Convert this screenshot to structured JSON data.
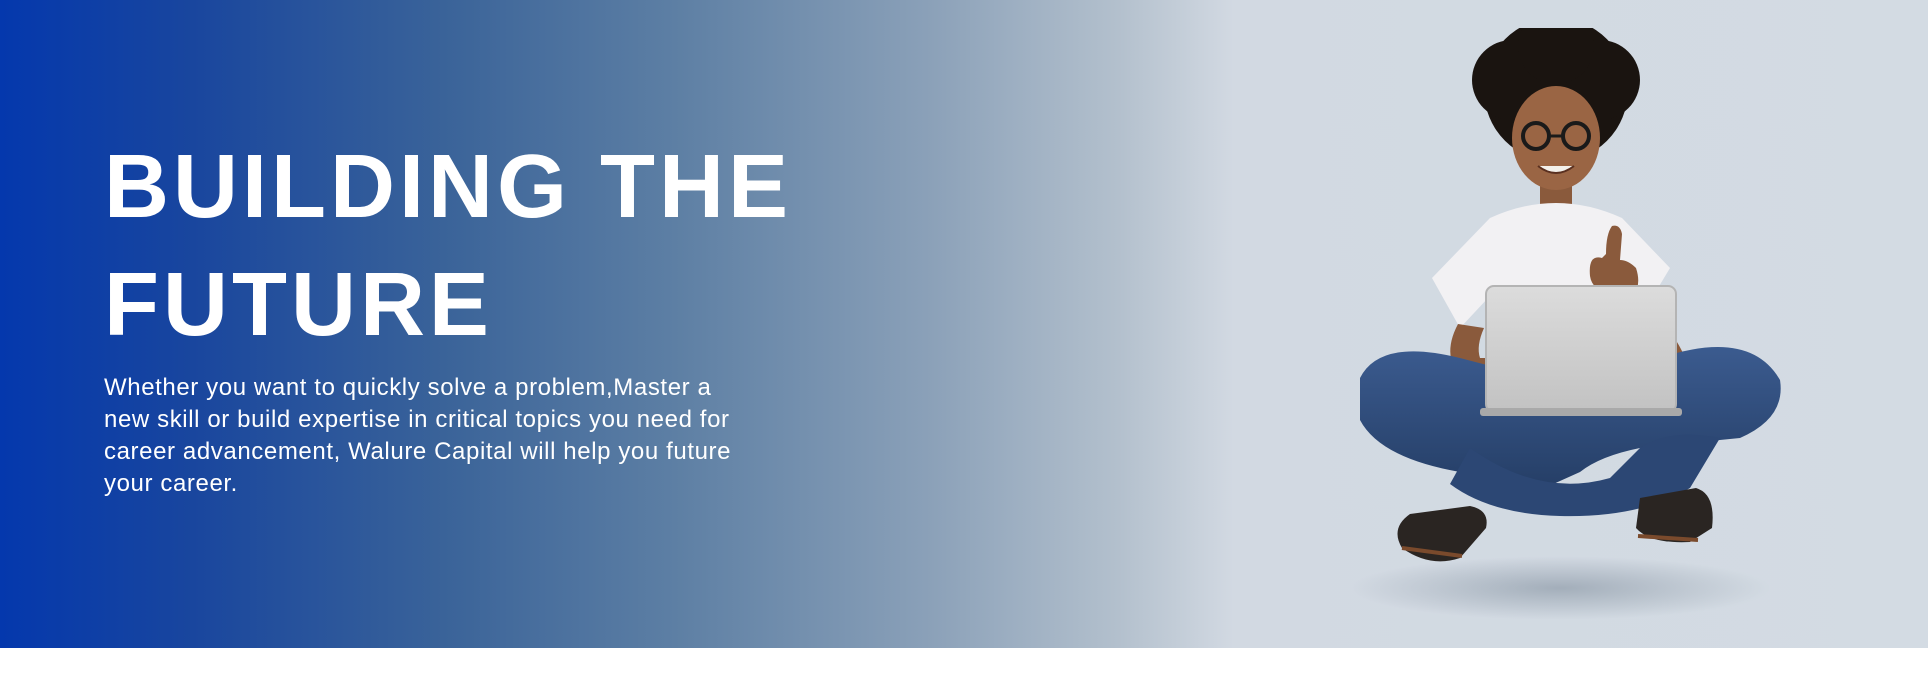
{
  "hero": {
    "headline_line1": "BUILDING THE",
    "headline_line2": "FUTURE",
    "description": "Whether you want to quickly solve a problem,Master a new skill or build expertise in critical topics you need for career advancement, Walure Capital will help you future your career.",
    "image_semantic": "person-with-laptop-thumbs-up",
    "colors": {
      "gradient_start": "#0438ad",
      "gradient_end": "#d3dbe3",
      "text": "#ffffff"
    }
  }
}
